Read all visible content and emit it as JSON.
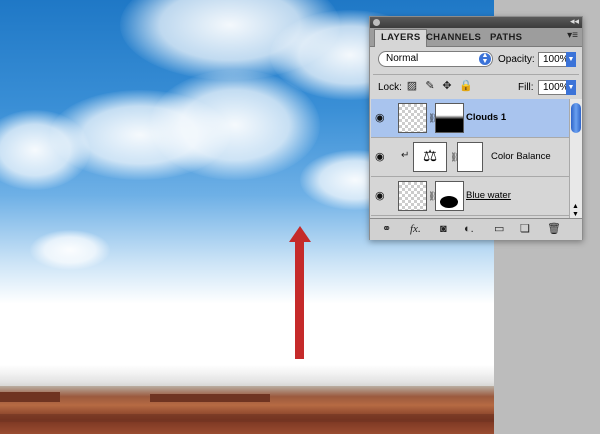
{
  "panel": {
    "tabs": [
      "LAYERS",
      "CHANNELS",
      "PATHS"
    ],
    "menu_icon": "panel-menu-icon",
    "blend_mode": "Normal",
    "opacity_label": "Opacity:",
    "opacity_value": "100%",
    "lock_label": "Lock:",
    "fill_label": "Fill:",
    "fill_value": "100%",
    "layers": [
      {
        "name": "Clouds 1",
        "selected": true
      },
      {
        "name": "Color Balance",
        "selected": false
      },
      {
        "name": "Blue water",
        "selected": false
      }
    ],
    "footer_icons": [
      "link-icon",
      "fx-icon",
      "mask-icon",
      "adjustment-icon",
      "group-icon",
      "new-layer-icon",
      "trash-icon"
    ]
  },
  "colors": {
    "arrow": "#c52a2a",
    "selection": "#a9c4ee",
    "accent": "#3b73d8"
  }
}
